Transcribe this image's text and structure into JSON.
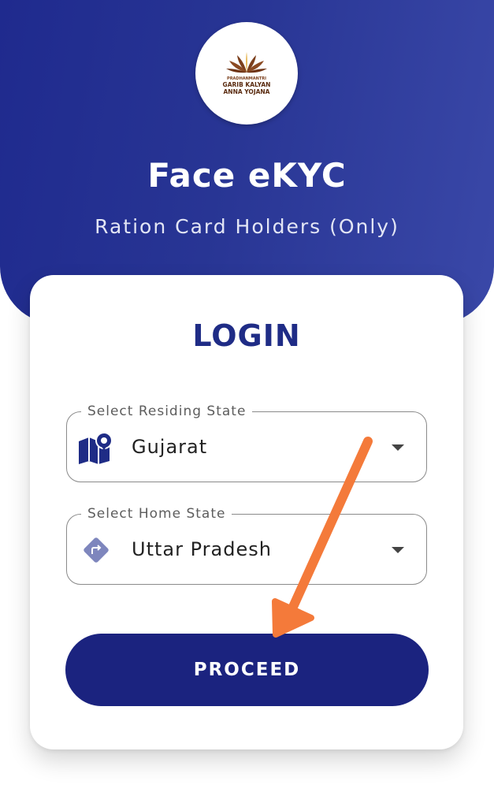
{
  "header": {
    "logo_lines": [
      "PRADHANMANTRI",
      "GARIB KALYAN",
      "ANNA YOJANA"
    ],
    "title": "Face eKYC",
    "subtitle": "Ration Card Holders (Only)"
  },
  "login": {
    "title": "LOGIN",
    "residing_state": {
      "label": "Select Residing State",
      "value": "Gujarat",
      "icon": "map-icon"
    },
    "home_state": {
      "label": "Select Home State",
      "value": "Uttar Pradesh",
      "icon": "directions-icon"
    },
    "proceed_label": "PROCEED"
  },
  "colors": {
    "primary": "#1b237f",
    "header_gradient_start": "#1f2a8e",
    "header_gradient_end": "#3a48a8",
    "annotation_arrow": "#f47a3a"
  }
}
